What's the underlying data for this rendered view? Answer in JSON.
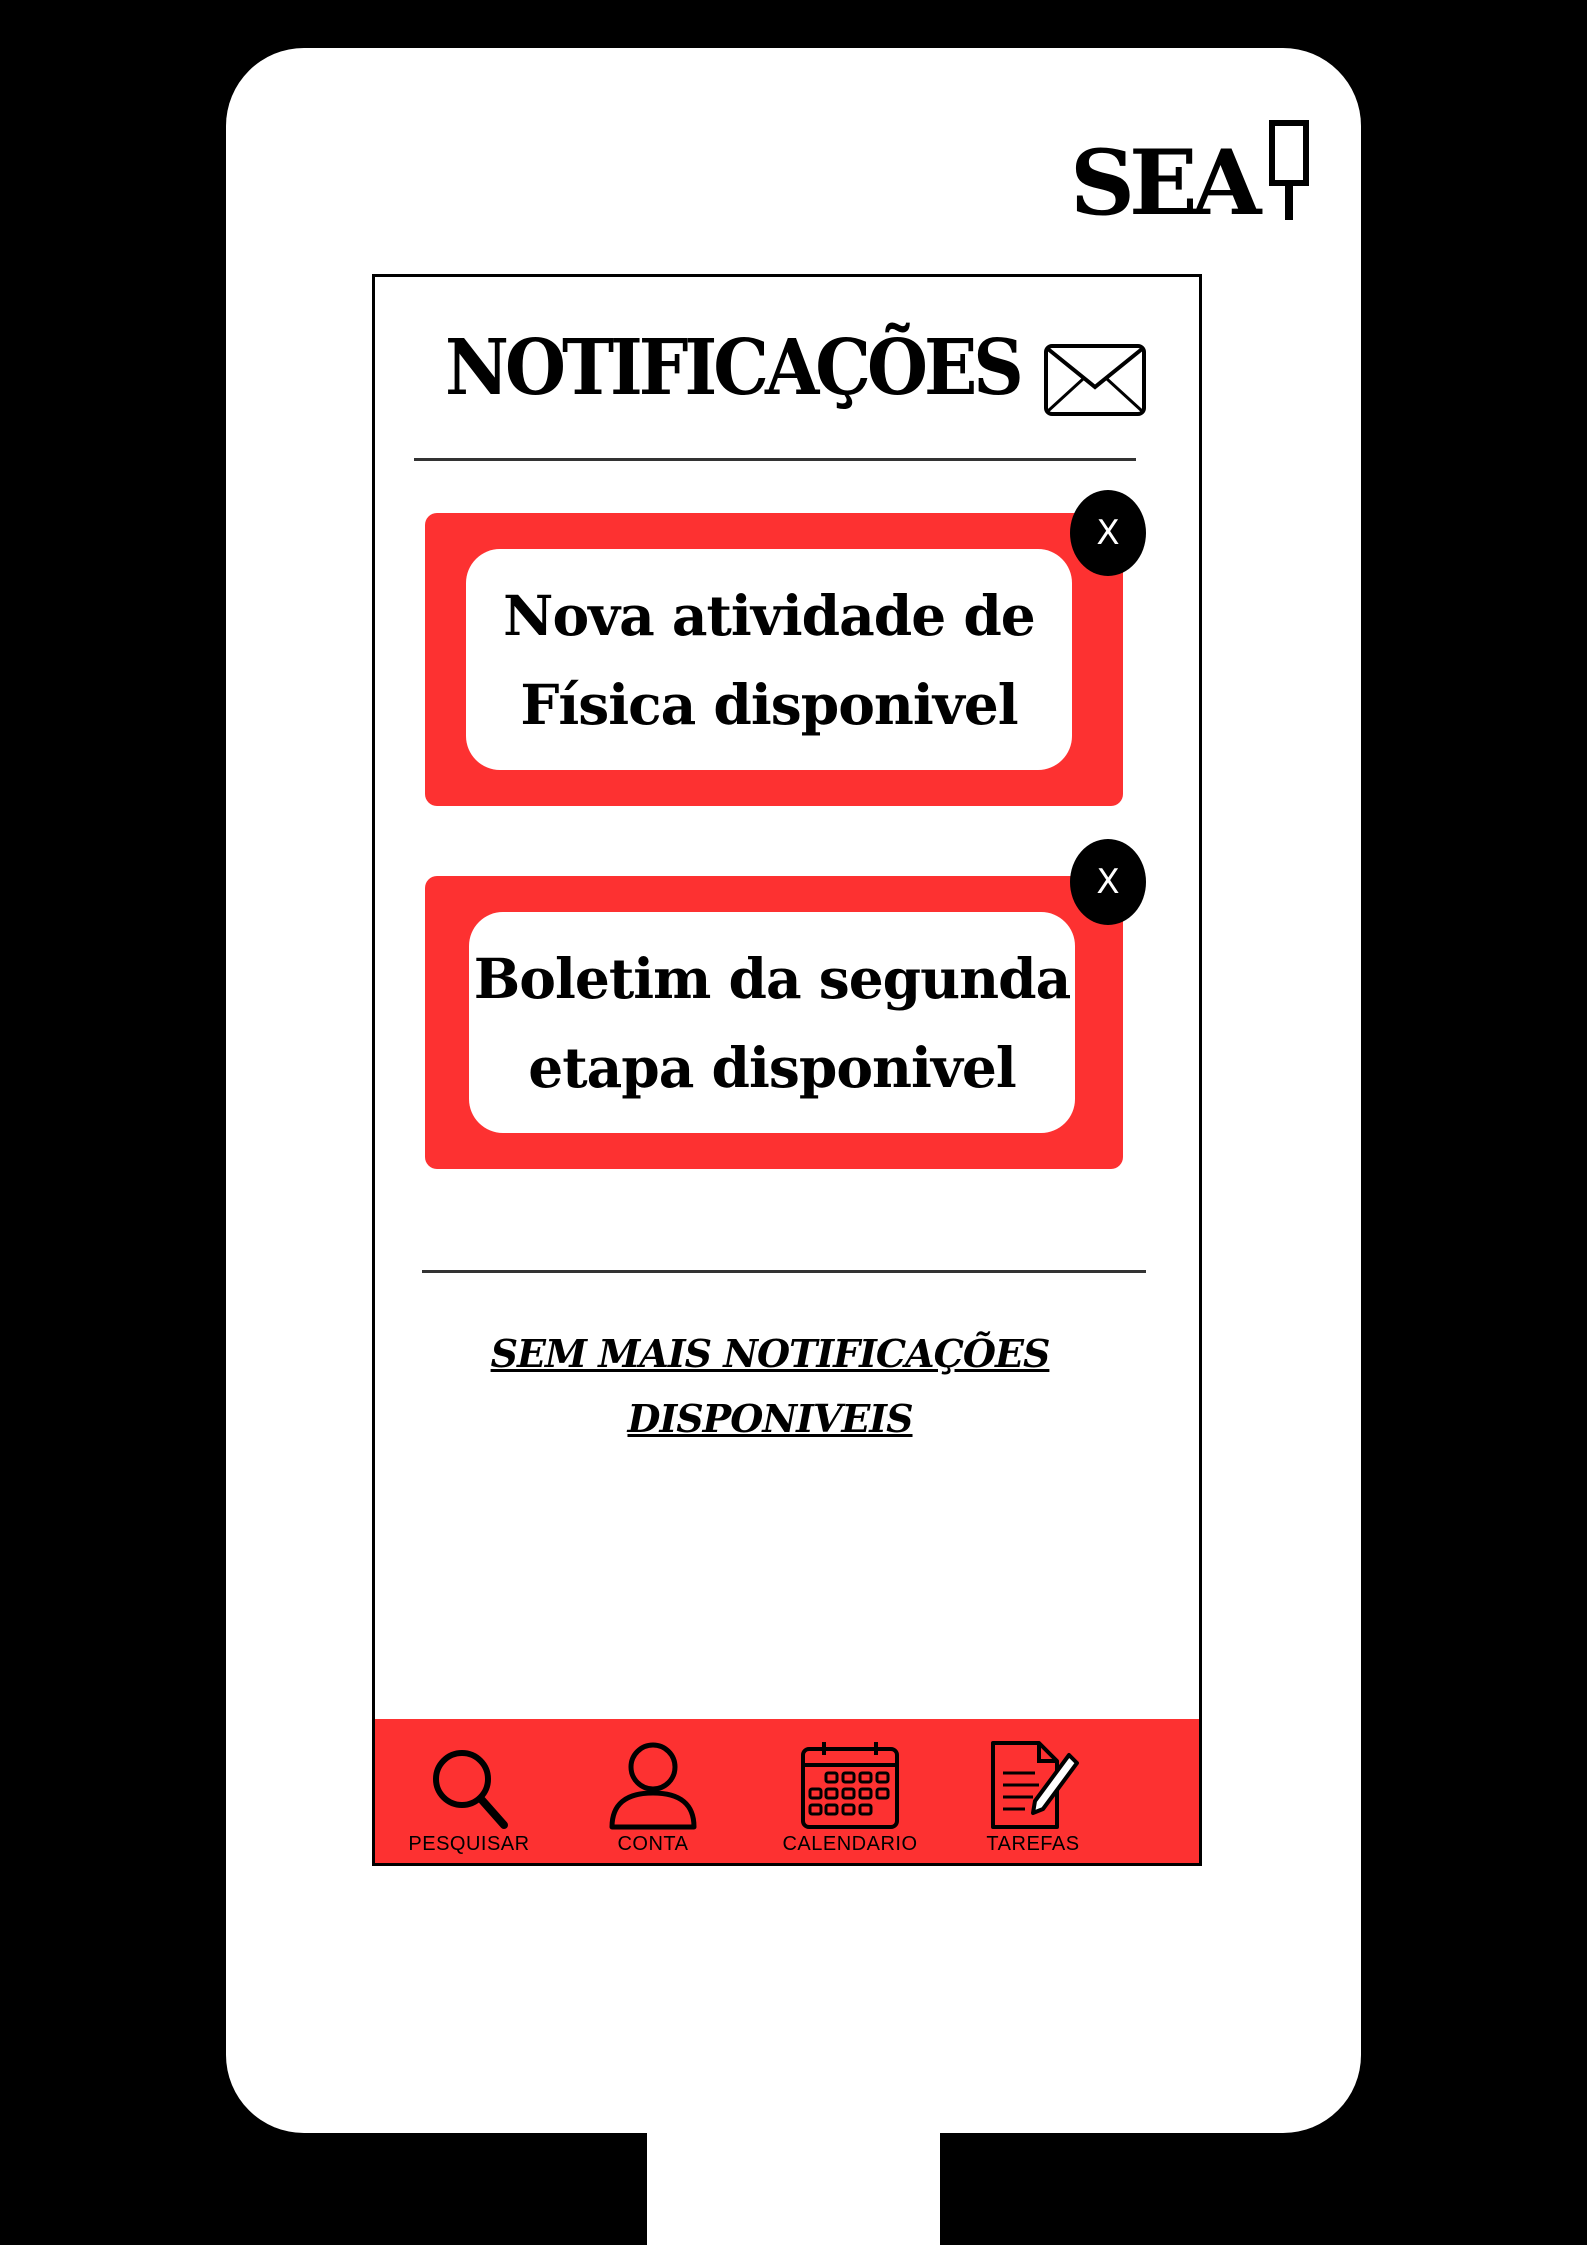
{
  "app": {
    "logo_text": "SEA"
  },
  "header": {
    "title": "NOTIFICAÇÕES",
    "mail_icon": "envelope-icon"
  },
  "notifications": [
    {
      "line1": "Nova atividade de",
      "line2": "Física disponivel",
      "close_label": "X"
    },
    {
      "line1": "Boletim da segunda",
      "line2": "etapa disponivel",
      "close_label": "X"
    }
  ],
  "empty_state": {
    "line1": "SEM MAIS NOTIFICAÇÕES",
    "line2": "DISPONIVEIS"
  },
  "nav": {
    "items": [
      {
        "label": "PESQUISAR",
        "icon": "search-icon"
      },
      {
        "label": "CONTA",
        "icon": "user-icon"
      },
      {
        "label": "CALENDARIO",
        "icon": "calendar-icon"
      },
      {
        "label": "TAREFAS",
        "icon": "tasks-icon"
      }
    ]
  },
  "colors": {
    "accent": "#fd3131",
    "background": "#000000",
    "device": "#ffffff"
  }
}
